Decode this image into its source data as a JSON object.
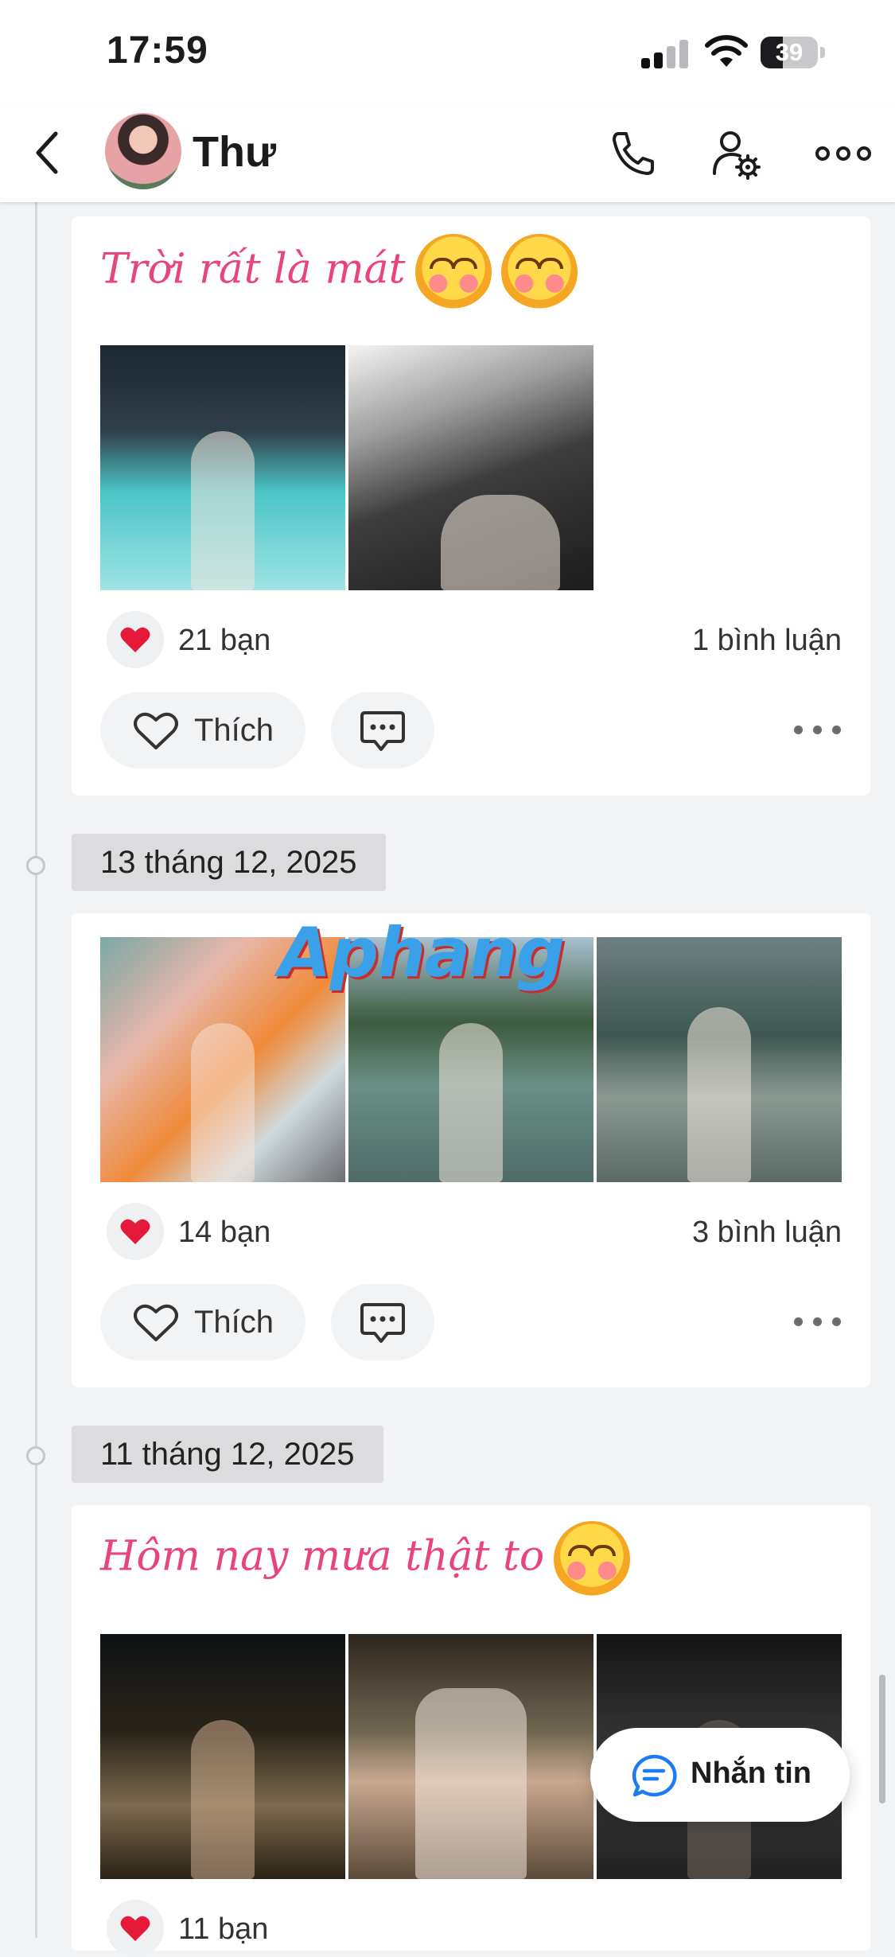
{
  "status_bar": {
    "time": "17:59",
    "battery": "39",
    "battery_level": 0.39
  },
  "header": {
    "contact_name": "Thư",
    "icons": [
      "back-chevron-icon",
      "phone-icon",
      "profile-settings-icon",
      "more-icon"
    ]
  },
  "posts": [
    {
      "caption": "Trời rất là mát",
      "caption_emojis": 2,
      "photos": 2,
      "reaction_count": "21 bạn",
      "comment_count": "1 bình luận",
      "like_label": "Thích"
    },
    {
      "date": "13 tháng 12, 2025",
      "watermark": "Aphang",
      "photos": 3,
      "reaction_count": "14 bạn",
      "comment_count": "3 bình luận",
      "like_label": "Thích"
    },
    {
      "date": "11 tháng 12, 2025",
      "caption": "Hôm nay mưa thật to",
      "caption_emojis": 1,
      "photos": 3,
      "reaction_count": "11 bạn"
    }
  ],
  "floating_button": {
    "label": "Nhắn tin"
  },
  "colors": {
    "accent_pink": "#e8457e",
    "heart_red": "#e5193a",
    "chip_bg": "#dcdcde",
    "page_bg": "#f2f3f5"
  }
}
